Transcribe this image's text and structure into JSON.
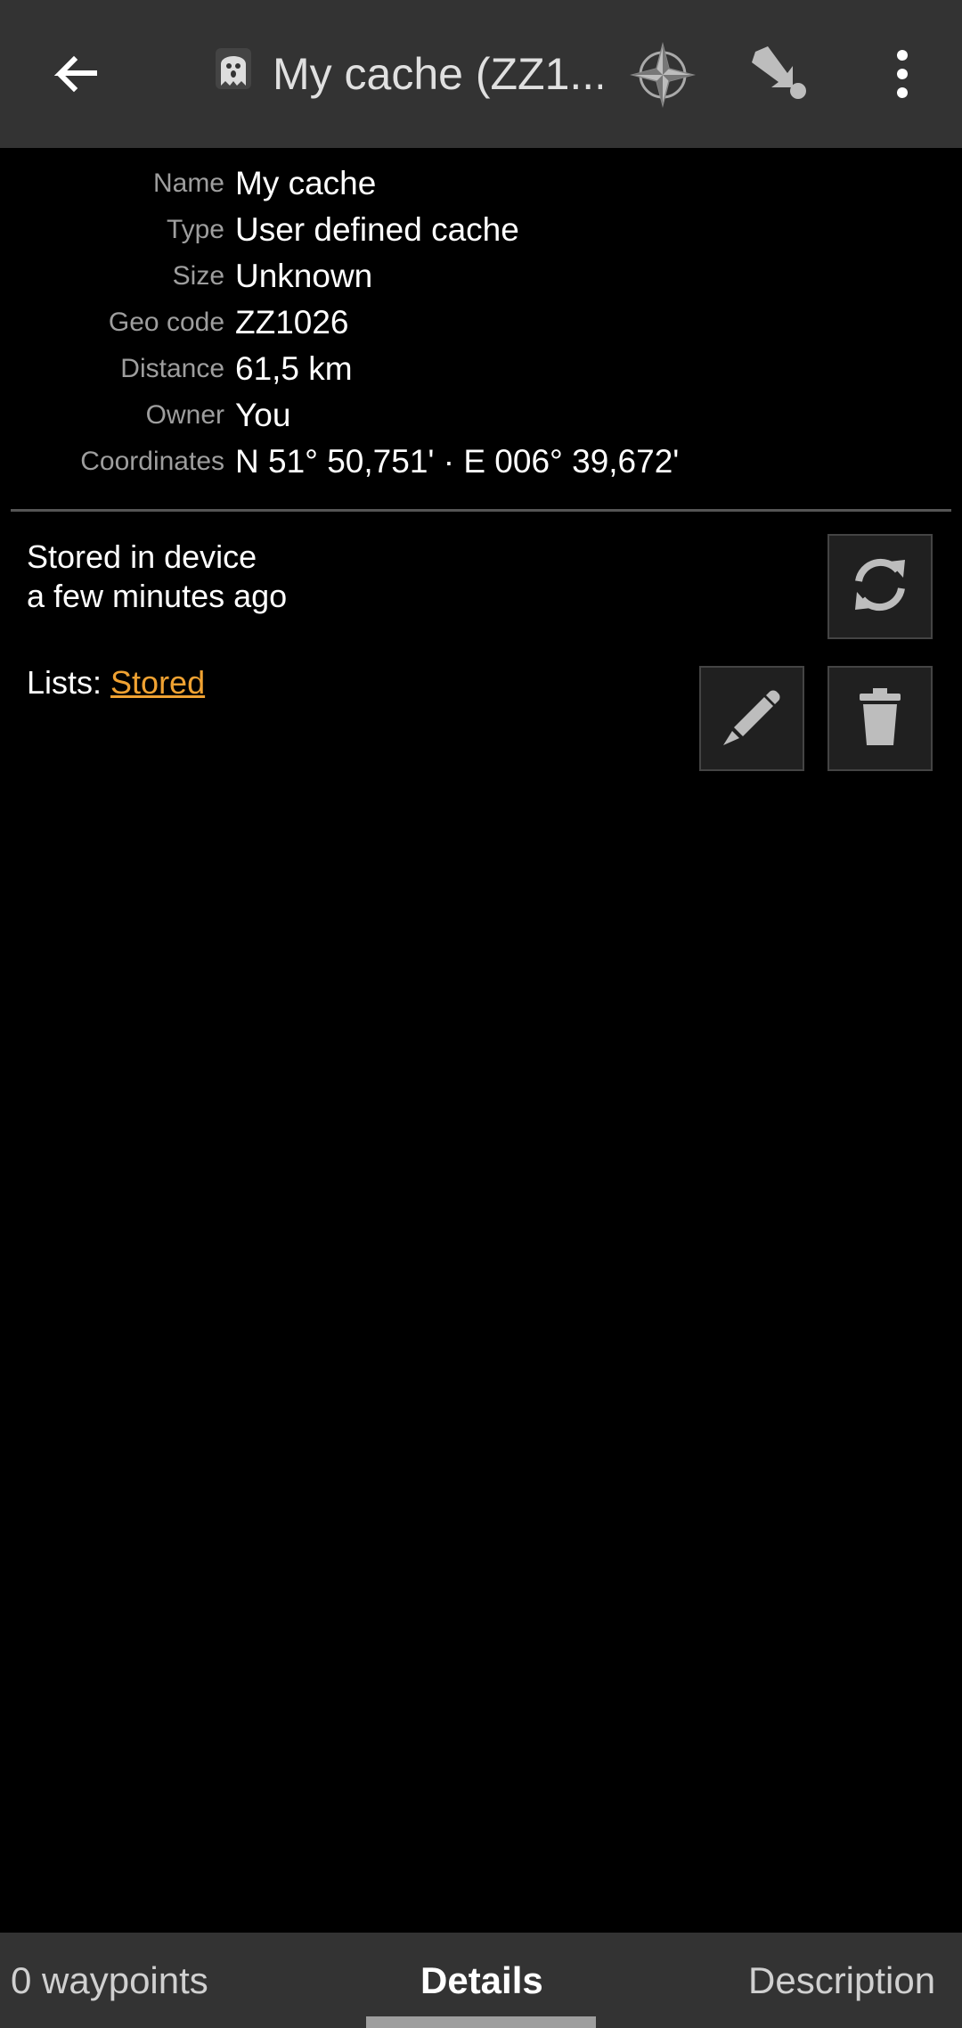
{
  "appbar": {
    "title": "My cache (ZZ1...",
    "back_icon": "arrow-left-icon",
    "cache_type_icon": "ghost-icon",
    "compass_icon": "compass-icon",
    "navigate_icon": "navigate-icon",
    "overflow_icon": "more-vert-icon"
  },
  "details": [
    {
      "label": "Name",
      "value": "My cache"
    },
    {
      "label": "Type",
      "value": "User defined cache"
    },
    {
      "label": "Size",
      "value": "Unknown"
    },
    {
      "label": "Geo code",
      "value": "ZZ1026"
    },
    {
      "label": "Distance",
      "value": "61,5 km"
    },
    {
      "label": "Owner",
      "value": "You"
    },
    {
      "label": "Coordinates",
      "value": "N 51° 50,751' · E 006° 39,672'"
    }
  ],
  "storage": {
    "line1": "Stored in device",
    "line2": "a few minutes ago",
    "refresh_icon": "refresh-icon"
  },
  "lists": {
    "prefix": "Lists: ",
    "link": "Stored",
    "edit_icon": "pencil-icon",
    "delete_icon": "trash-icon"
  },
  "tabs": [
    {
      "label": "0 waypoints",
      "active": false
    },
    {
      "label": "Details",
      "active": true
    },
    {
      "label": "Description",
      "active": false
    }
  ],
  "colors": {
    "appbar_bg": "#333333",
    "background": "#000000",
    "link": "#f0a232",
    "label": "#9e9e9e"
  }
}
